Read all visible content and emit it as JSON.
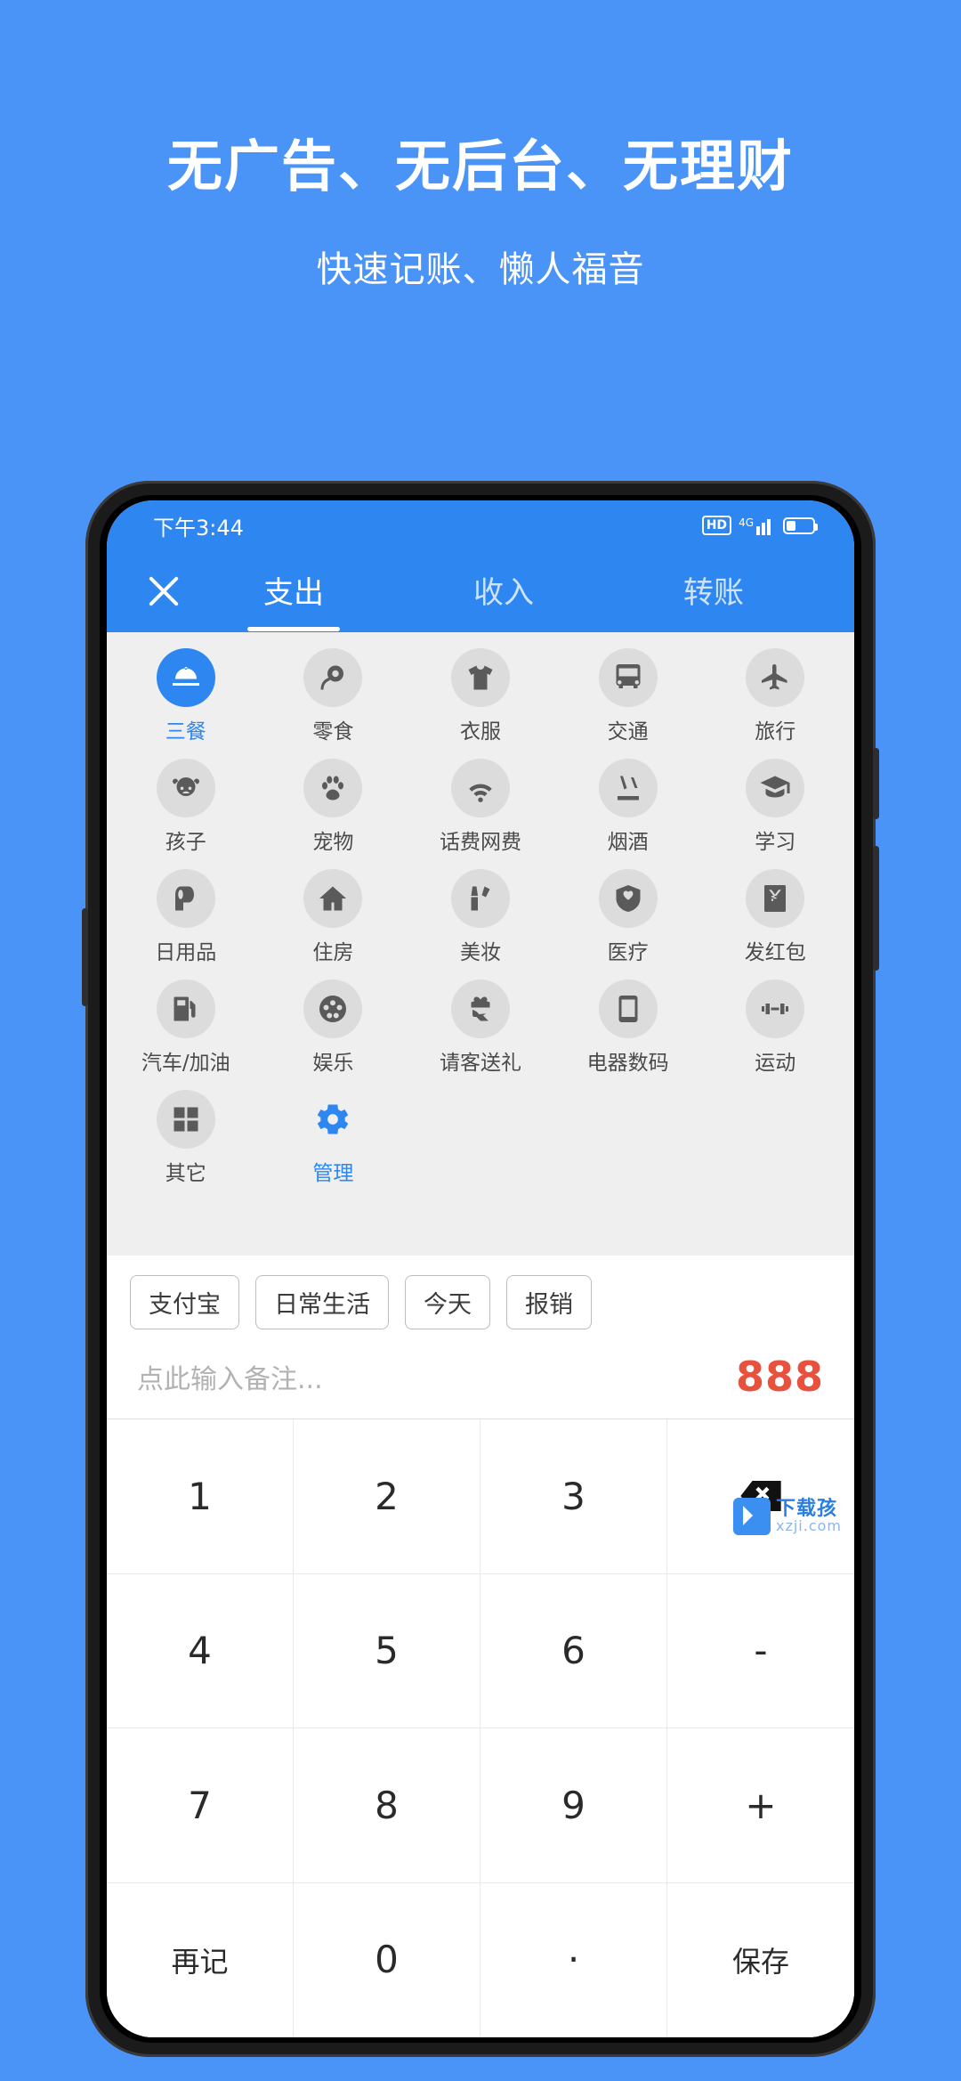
{
  "promo": {
    "title": "无广告、无后台、无理财",
    "subtitle": "快速记账、懒人福音"
  },
  "colors": {
    "background": "#4a93f7",
    "app_bar": "#2e86f0",
    "accent": "#2e86f0",
    "amount": "#e8513d",
    "grid_bg": "#efefef"
  },
  "status_bar": {
    "time": "下午3:44",
    "hd_label": "HD",
    "network": "4G"
  },
  "app_bar": {
    "close_icon": "close-icon",
    "tabs": [
      {
        "label": "支出",
        "active": true
      },
      {
        "label": "收入",
        "active": false
      },
      {
        "label": "转账",
        "active": false
      }
    ]
  },
  "categories": [
    {
      "label": "三餐",
      "icon": "meal-icon",
      "selected": true
    },
    {
      "label": "零食",
      "icon": "candy-icon",
      "selected": false
    },
    {
      "label": "衣服",
      "icon": "tshirt-icon",
      "selected": false
    },
    {
      "label": "交通",
      "icon": "bus-icon",
      "selected": false
    },
    {
      "label": "旅行",
      "icon": "airplane-icon",
      "selected": false
    },
    {
      "label": "孩子",
      "icon": "child-icon",
      "selected": false
    },
    {
      "label": "宠物",
      "icon": "paw-icon",
      "selected": false
    },
    {
      "label": "话费网费",
      "icon": "wifi-icon",
      "selected": false
    },
    {
      "label": "烟酒",
      "icon": "cigarette-icon",
      "selected": false
    },
    {
      "label": "学习",
      "icon": "graduation-cap-icon",
      "selected": false
    },
    {
      "label": "日用品",
      "icon": "paper-roll-icon",
      "selected": false
    },
    {
      "label": "住房",
      "icon": "home-icon",
      "selected": false
    },
    {
      "label": "美妆",
      "icon": "lipstick-icon",
      "selected": false
    },
    {
      "label": "医疗",
      "icon": "heart-shield-icon",
      "selected": false
    },
    {
      "label": "发红包",
      "icon": "red-envelope-icon",
      "selected": false
    },
    {
      "label": "汽车/加油",
      "icon": "fuel-pump-icon",
      "selected": false
    },
    {
      "label": "娱乐",
      "icon": "film-reel-icon",
      "selected": false
    },
    {
      "label": "请客送礼",
      "icon": "gift-hand-icon",
      "selected": false
    },
    {
      "label": "电器数码",
      "icon": "smartphone-icon",
      "selected": false
    },
    {
      "label": "运动",
      "icon": "dumbbell-icon",
      "selected": false
    },
    {
      "label": "其它",
      "icon": "grid-squares-icon",
      "selected": false
    },
    {
      "label": "管理",
      "icon": "gear-icon",
      "selected": false,
      "manage": true
    }
  ],
  "chips": [
    {
      "label": "支付宝"
    },
    {
      "label": "日常生活"
    },
    {
      "label": "今天"
    },
    {
      "label": "报销"
    }
  ],
  "entry": {
    "note_placeholder": "点此输入备注...",
    "amount": "888"
  },
  "keypad": [
    {
      "label": "1",
      "name": "key-1"
    },
    {
      "label": "2",
      "name": "key-2"
    },
    {
      "label": "3",
      "name": "key-3"
    },
    {
      "label": "",
      "name": "key-backspace",
      "icon": "backspace-icon"
    },
    {
      "label": "4",
      "name": "key-4"
    },
    {
      "label": "5",
      "name": "key-5"
    },
    {
      "label": "6",
      "name": "key-6"
    },
    {
      "label": "-",
      "name": "key-minus"
    },
    {
      "label": "7",
      "name": "key-7"
    },
    {
      "label": "8",
      "name": "key-8"
    },
    {
      "label": "9",
      "name": "key-9"
    },
    {
      "label": "+",
      "name": "key-plus"
    },
    {
      "label": "再记",
      "name": "key-again",
      "small": true
    },
    {
      "label": "0",
      "name": "key-0"
    },
    {
      "label": "·",
      "name": "key-dot"
    },
    {
      "label": "保存",
      "name": "key-save",
      "small": true
    }
  ],
  "watermark": {
    "line1": "下载孩",
    "line2": "xzji.com"
  }
}
